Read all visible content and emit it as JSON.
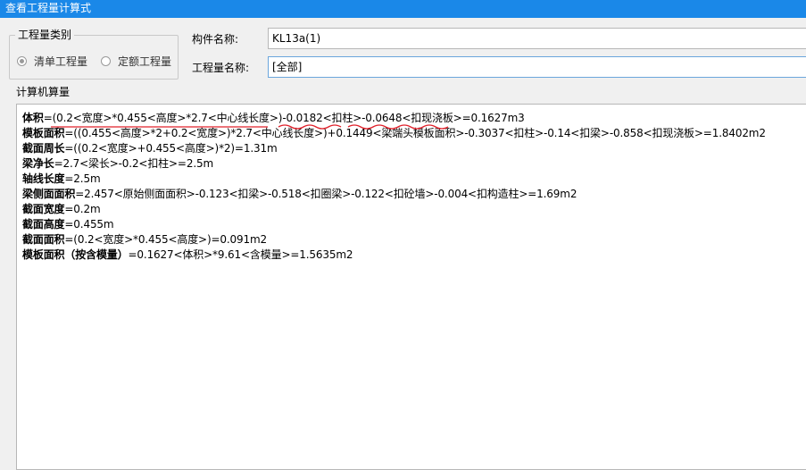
{
  "window": {
    "title": "查看工程量计算式"
  },
  "quantity_type": {
    "group_title": "工程量类别",
    "options": [
      {
        "label": "清单工程量",
        "selected": true
      },
      {
        "label": "定额工程量",
        "selected": false
      }
    ]
  },
  "component": {
    "label": "构件名称:",
    "value": "KL13a(1)"
  },
  "quantity_name": {
    "label": "工程量名称:",
    "value": "[全部]"
  },
  "calc": {
    "title": "计算机算量",
    "lines": [
      {
        "name": "体积",
        "formula": "=(0.2<宽度>*0.455<高度>*2.7<中心线长度>)-0.0182<扣柱>-0.0648<扣现浇板>=0.1627m3"
      },
      {
        "name": "模板面积",
        "formula": "=((0.455<高度>*2+0.2<宽度>)*2.7<中心线长度>)+0.1449<梁端头模板面积>-0.3037<扣柱>-0.14<扣梁>-0.858<扣现浇板>=1.8402m2"
      },
      {
        "name": "截面周长",
        "formula": "=((0.2<宽度>+0.455<高度>)*2)=1.31m"
      },
      {
        "name": "梁净长",
        "formula": "=2.7<梁长>-0.2<扣柱>=2.5m"
      },
      {
        "name": "轴线长度",
        "formula": "=2.5m"
      },
      {
        "name": "梁侧面面积",
        "formula": "=2.457<原始侧面面积>-0.123<扣梁>-0.518<扣圈梁>-0.122<扣砼墙>-0.004<扣构造柱>=1.69m2"
      },
      {
        "name": "截面宽度",
        "formula": "=0.2m"
      },
      {
        "name": "截面高度",
        "formula": "=0.455m"
      },
      {
        "name": "截面面积",
        "formula": "=(0.2<宽度>*0.455<高度>)=0.091m2"
      },
      {
        "name": "模板面积（按含模量）",
        "formula": "=0.1627<体积>*9.61<含模量>=1.5635m2"
      }
    ]
  },
  "annotation_color": "#e0202a",
  "accent_color": "#1a88e8"
}
